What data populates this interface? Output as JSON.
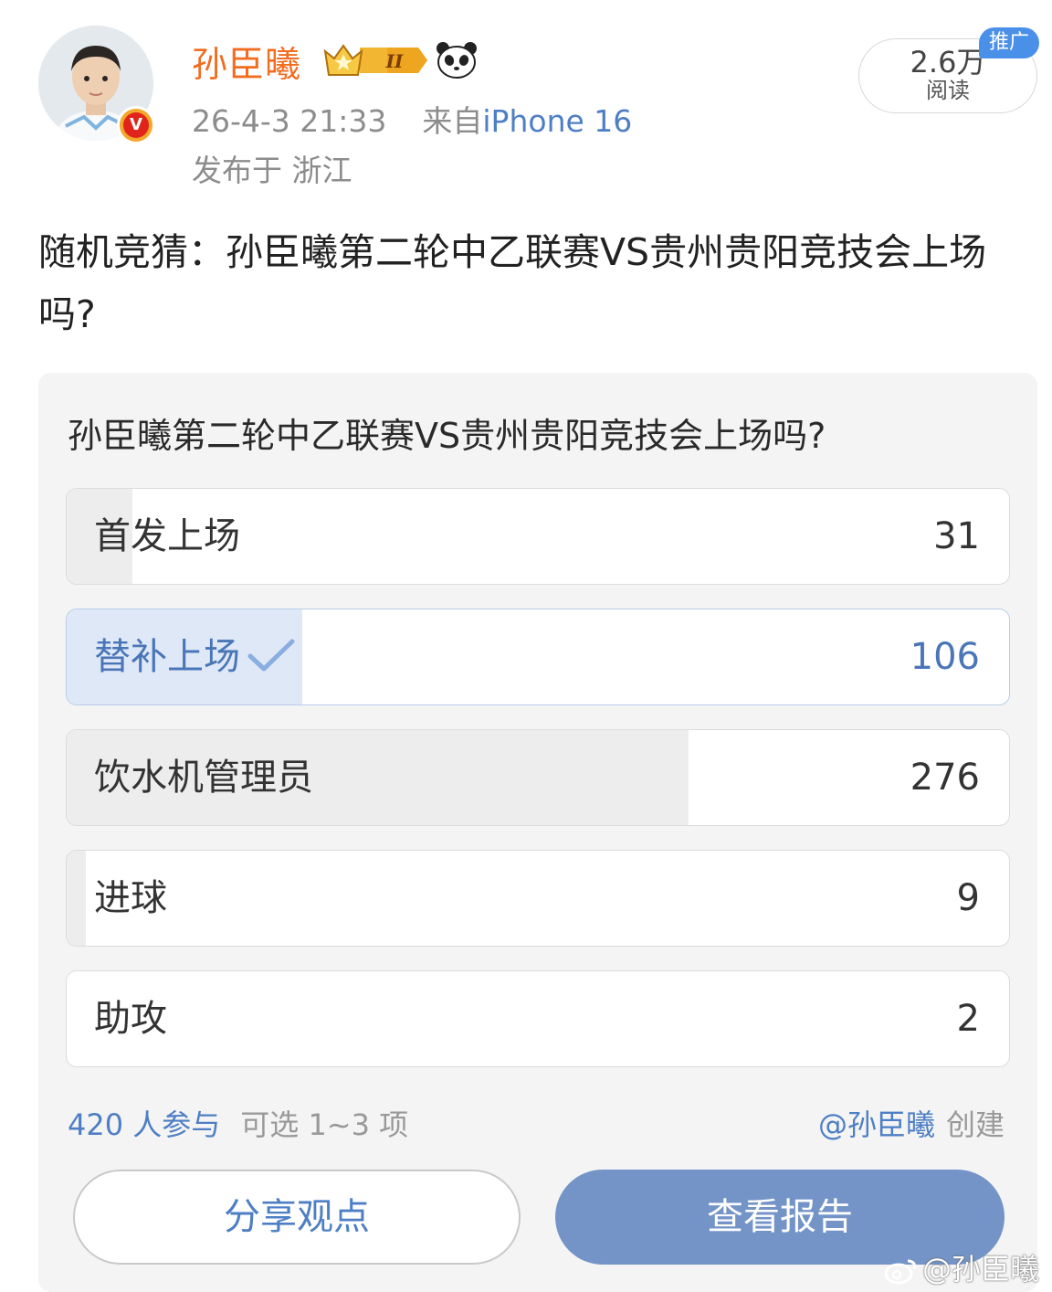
{
  "user": {
    "name": "孙臣曦",
    "vip_level": "II",
    "timestamp": "26-4-3 21:33",
    "source_prefix": "来自",
    "device": "iPhone 16",
    "location": "发布于 浙江",
    "verified_badge": "V"
  },
  "stats": {
    "reads_value": "2.6万",
    "reads_label": "阅读",
    "promo_tag": "推广"
  },
  "post": {
    "text": "随机竞猜：孙臣曦第二轮中乙联赛VS贵州贵阳竞技会上场吗?"
  },
  "poll": {
    "question": "孙臣曦第二轮中乙联赛VS贵州贵阳竞技会上场吗?",
    "options": [
      {
        "label": "首发上场",
        "count": "31",
        "share": 0.07,
        "selected": false
      },
      {
        "label": "替补上场",
        "count": "106",
        "share": 0.25,
        "selected": true
      },
      {
        "label": "饮水机管理员",
        "count": "276",
        "share": 0.66,
        "selected": false
      },
      {
        "label": "进球",
        "count": "9",
        "share": 0.02,
        "selected": false
      },
      {
        "label": "助攻",
        "count": "2",
        "share": 0.0,
        "selected": false
      }
    ],
    "participants": "420 人参与",
    "rule": "可选 1~3 项",
    "creator": "@孙臣曦",
    "created_label": "创建",
    "share_button": "分享观点",
    "report_button": "查看报告"
  },
  "watermark": "@孙臣曦",
  "colors": {
    "name": "#f26d1f",
    "link": "#4e7fc4",
    "selected_fill": "#dfe8f6",
    "report_button": "#7494c8",
    "promo": "#4a90e8"
  },
  "icons": [
    "avatar",
    "verified-badge-icon",
    "vip-crown-icon",
    "panda-icon",
    "checkmark-icon",
    "weibo-logo-icon"
  ]
}
